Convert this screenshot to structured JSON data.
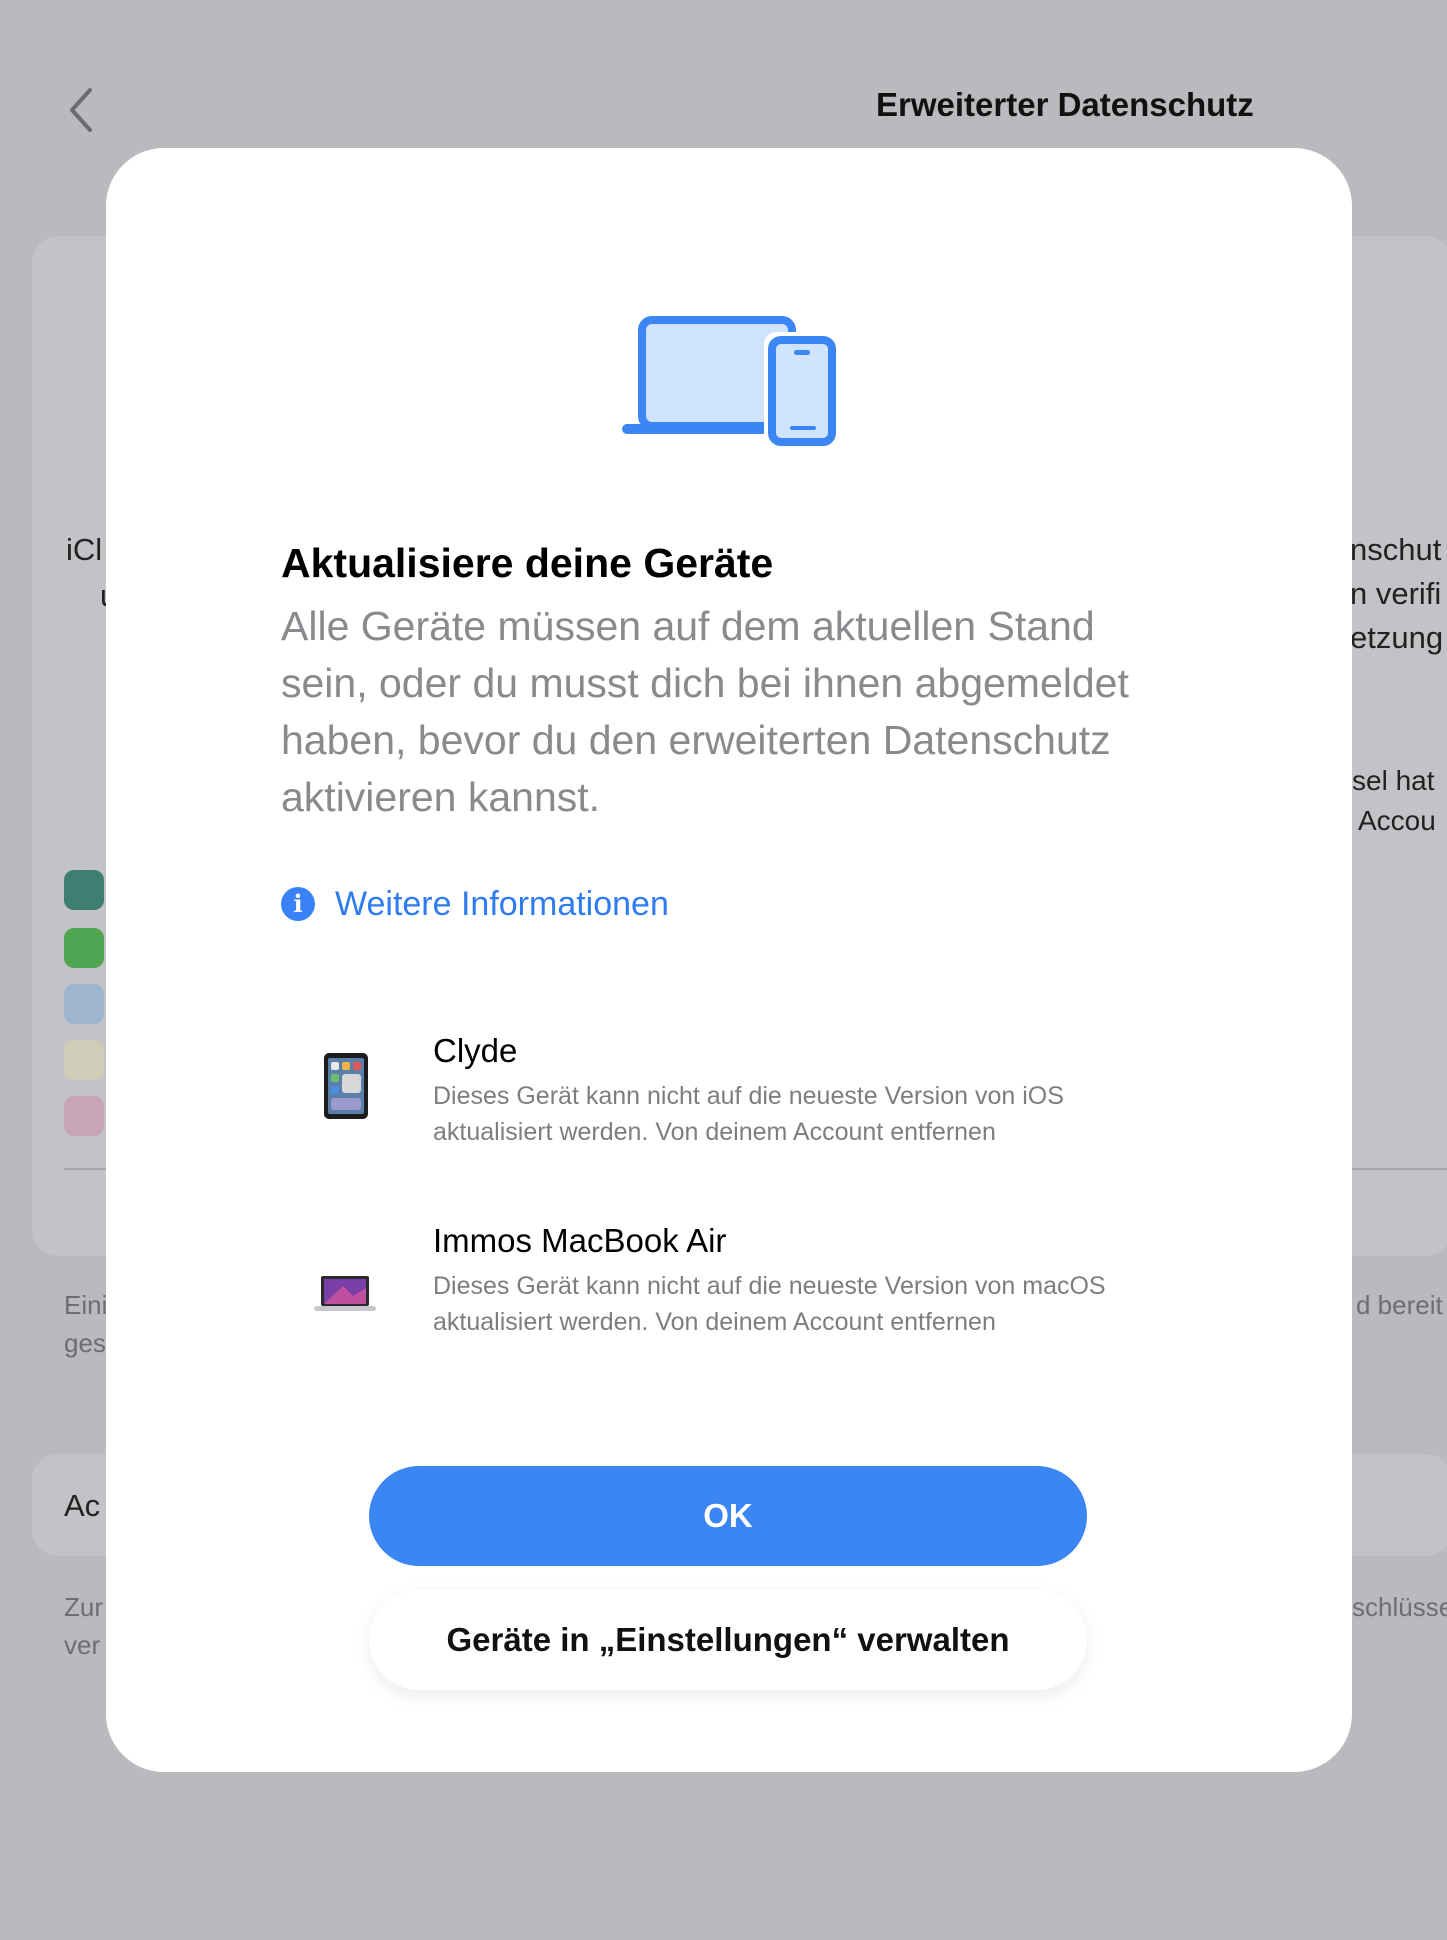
{
  "background": {
    "title": "Erweiterter Datenschutz",
    "left_fragments": [
      "iCl",
      "u",
      "Eini",
      "ges",
      "Ac",
      "Zur",
      "ver"
    ],
    "right_fragments": [
      "nschut",
      "n verifi",
      "etzung",
      "sel hat",
      "Accou",
      "d bereit",
      "schlüsse"
    ]
  },
  "modal": {
    "hero_icon": "laptop-and-phone-icon",
    "heading": "Aktualisiere deine Geräte",
    "description": "Alle Geräte müssen auf dem aktuellen Stand sein, oder du musst dich bei ihnen abgemeldet haben, bevor du den erweiterten Datenschutz aktivieren kannst.",
    "more_info": "Weitere Informationen",
    "devices": [
      {
        "name": "Clyde",
        "icon": "ipad-icon",
        "description": "Dieses Gerät kann nicht auf die neueste Version von iOS aktualisiert werden. Von deinem Account entfernen"
      },
      {
        "name": "Immos MacBook Air",
        "icon": "macbook-icon",
        "description": "Dieses Gerät kann nicht auf die neueste Version von macOS aktualisiert werden. Von deinem Account entfernen"
      }
    ],
    "ok_button": "OK",
    "manage_button": "Geräte in „Einstellungen“ verwalten"
  },
  "colors": {
    "accent": "#3b86f3",
    "link": "#2f7cf0",
    "overlay": "#b9babd"
  }
}
